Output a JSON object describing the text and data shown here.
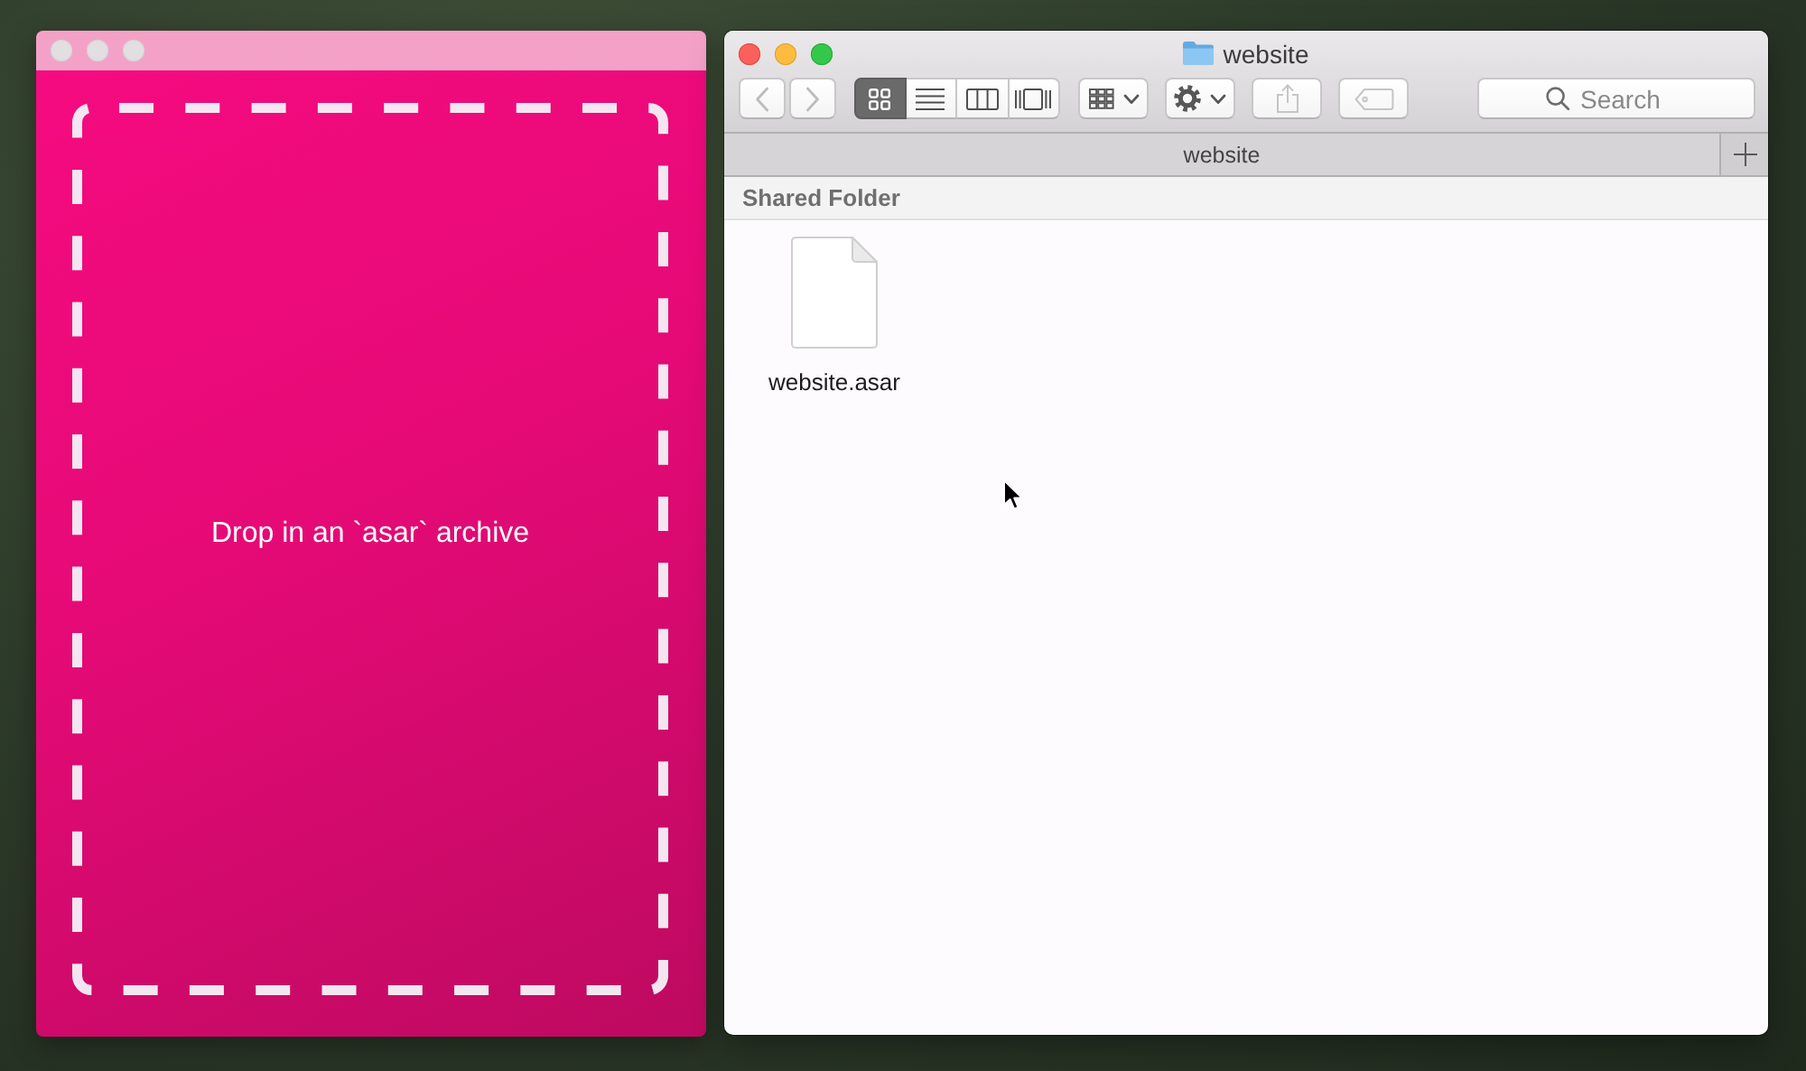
{
  "drop_window": {
    "active": false,
    "message": "Drop in an `asar` archive"
  },
  "finder": {
    "active": true,
    "title": "website",
    "nav_buttons": [
      {
        "kind": "back",
        "disabled": true
      },
      {
        "kind": "forward",
        "disabled": true
      }
    ],
    "view_modes": [
      {
        "kind": "icons",
        "selected": true
      },
      {
        "kind": "list",
        "selected": false
      },
      {
        "kind": "columns",
        "selected": false
      },
      {
        "kind": "gallery",
        "selected": false
      }
    ],
    "toolbar_buttons": [
      {
        "kind": "group",
        "disabled": false
      },
      {
        "kind": "action",
        "disabled": false
      },
      {
        "kind": "share",
        "disabled": true
      },
      {
        "kind": "tag",
        "disabled": true
      }
    ],
    "search": {
      "placeholder": "Search"
    },
    "tabs": [
      {
        "label": "website"
      }
    ],
    "section": {
      "title": "Shared Folder",
      "files": [
        {
          "name": "website.asar"
        }
      ]
    }
  }
}
